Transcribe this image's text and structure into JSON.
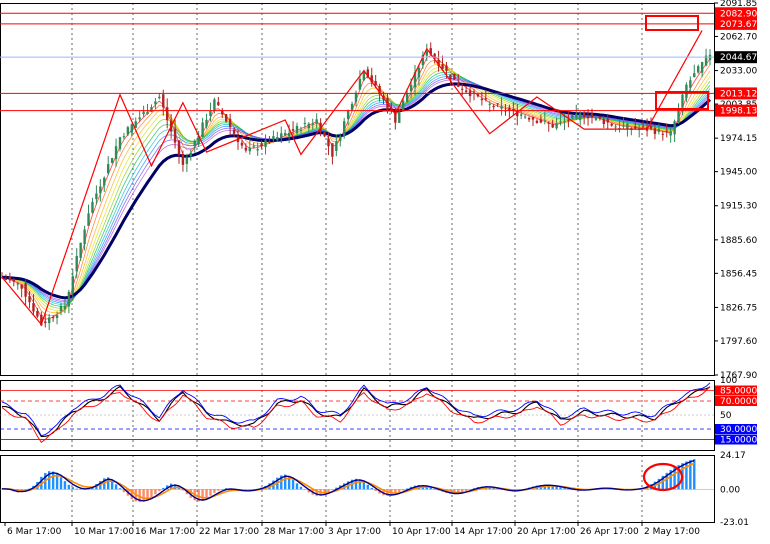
{
  "colors": {
    "bull": "#2e8b57",
    "bear": "#b22222",
    "zigzag": "#ff0000",
    "ma_slow": "#000066",
    "level": "#ff0000",
    "current": "#9bb4ff",
    "macd_up": "#1e90ff",
    "macd_down": "#ff8a65",
    "signal": "#ff8c00",
    "macd_line": "#00008b",
    "rsi_main": "#000000",
    "rsi_fast": "#0000ff",
    "rsi_slow": "#ff0000",
    "box": "#ff0000"
  },
  "chart_data": [
    {
      "type": "candlestick",
      "name": "price",
      "ylim": [
        1767.9,
        2091.85
      ],
      "yticks": [
        2091.85,
        2062.7,
        2033.0,
        2003.85,
        1974.15,
        1945.0,
        1915.3,
        1885.6,
        1856.45,
        1826.75,
        1797.6,
        1767.9
      ],
      "xlabels": [
        "6 Mar 17:00",
        "10 Mar 17:00",
        "16 Mar 17:00",
        "22 Mar 17:00",
        "28 Mar 17:00",
        "3 Apr 17:00",
        "10 Apr 17:00",
        "14 Apr 17:00",
        "20 Apr 17:00",
        "26 Apr 17:00",
        "2 May 17:00"
      ],
      "levels": [
        {
          "value": 2082.9,
          "label": "2082.90",
          "style": "line"
        },
        {
          "value": 2073.67,
          "label": "2073.67",
          "style": "line"
        },
        {
          "value": 2044.67,
          "label": "2044.67",
          "style": "current"
        },
        {
          "value": 2013.12,
          "label": "2013.12",
          "style": "line"
        },
        {
          "value": 1998.13,
          "label": "1998.13",
          "style": "line"
        }
      ],
      "path": [
        [
          0,
          1853
        ],
        [
          5,
          1845
        ],
        [
          10,
          1812
        ],
        [
          16,
          1828
        ],
        [
          22,
          1910
        ],
        [
          30,
          1975
        ],
        [
          40,
          2010
        ],
        [
          46,
          1950
        ],
        [
          54,
          2006
        ],
        [
          62,
          1962
        ],
        [
          72,
          1978
        ],
        [
          80,
          1990
        ],
        [
          84,
          1960
        ],
        [
          92,
          2035
        ],
        [
          100,
          1990
        ],
        [
          108,
          2052
        ],
        [
          116,
          2020
        ],
        [
          124,
          2003
        ],
        [
          132,
          1995
        ],
        [
          140,
          1985
        ],
        [
          148,
          1995
        ],
        [
          156,
          1985
        ],
        [
          164,
          1982
        ],
        [
          170,
          1978
        ],
        [
          174,
          2020
        ],
        [
          180,
          2048
        ]
      ],
      "zigzag": [
        [
          0,
          1853
        ],
        [
          10,
          1812
        ],
        [
          30,
          2012
        ],
        [
          38,
          1950
        ],
        [
          46,
          2005
        ],
        [
          52,
          1962
        ],
        [
          72,
          1990
        ],
        [
          76,
          1960
        ],
        [
          92,
          2033
        ],
        [
          100,
          1995
        ],
        [
          108,
          2052
        ],
        [
          124,
          1978
        ],
        [
          136,
          2010
        ],
        [
          148,
          1982
        ],
        [
          164,
          1982
        ],
        [
          178,
          2068
        ]
      ],
      "macd": [
        0.4,
        0.2,
        -0.2,
        -1.5,
        -2.2,
        -1.8,
        -1.0,
        0.5,
        2.5,
        5.2,
        8.8,
        11.5,
        12.8,
        12.5,
        10.8,
        8.5,
        5.8,
        3.2,
        1.5,
        0.5,
        -0.4,
        -0.2,
        0.8,
        2.0,
        3.8,
        5.8,
        7.8,
        8.4,
        6.2,
        3.5,
        0.8,
        -2.0,
        -4.5,
        -7.0,
        -8.5,
        -9.0,
        -8.5,
        -7.0,
        -5.5,
        -3.5,
        -1.2,
        1.0,
        2.8,
        4.0,
        3.5,
        1.8,
        -0.8,
        -3.5,
        -6.0,
        -7.8,
        -8.5,
        -8.0,
        -6.5,
        -4.5,
        -2.5,
        -1.0,
        0.2,
        0.8,
        0.6,
        0.0,
        -0.6,
        -1.2,
        -1.4,
        -1.0,
        -0.4,
        0.4,
        1.2,
        2.4,
        4.2,
        6.2,
        8.2,
        9.8,
        10.4,
        9.0,
        6.8,
        4.2,
        1.8,
        -0.3,
        -2.2,
        -3.8,
        -4.8,
        -4.5,
        -3.5,
        -2.0,
        -0.4,
        1.2,
        2.8,
        4.2,
        5.6,
        6.8,
        7.4,
        6.8,
        5.2,
        3.2,
        1.0,
        -1.2,
        -3.0,
        -4.2,
        -4.6,
        -4.3,
        -3.4,
        -2.1,
        -0.8,
        0.6,
        1.8,
        2.6,
        3.0,
        2.8,
        2.2,
        1.2,
        0.2,
        -0.8,
        -1.8,
        -2.6,
        -3.2,
        -3.4,
        -3.0,
        -2.2,
        -1.2,
        -0.2,
        0.8,
        1.6,
        2.0,
        2.2,
        1.8,
        1.2,
        0.5,
        -0.2,
        -0.8,
        -1.2,
        -1.4,
        -1.0,
        -0.4,
        0.4,
        1.2,
        2.0,
        2.6,
        3.0,
        3.2,
        3.0,
        2.6,
        2.0,
        1.4,
        0.8,
        0.2,
        -0.3,
        -0.6,
        -0.8,
        -0.6,
        -0.2,
        0.2,
        0.6,
        0.9,
        1.0,
        0.8,
        0.4,
        0.0,
        -0.4,
        -0.6,
        -0.5,
        -0.2,
        0.2,
        0.6,
        1.2,
        2.2,
        3.6,
        5.4,
        7.4,
        9.5,
        11.6,
        13.6,
        15.4,
        17.0,
        18.4,
        19.6,
        20.6,
        21.2
      ],
      "rsi_breaks": [
        [
          0,
          62
        ],
        [
          6,
          48
        ],
        [
          10,
          18
        ],
        [
          14,
          30
        ],
        [
          18,
          56
        ],
        [
          26,
          75
        ],
        [
          30,
          88
        ],
        [
          36,
          62
        ],
        [
          40,
          44
        ],
        [
          46,
          84
        ],
        [
          52,
          52
        ],
        [
          58,
          38
        ],
        [
          64,
          36
        ],
        [
          70,
          66
        ],
        [
          76,
          72
        ],
        [
          80,
          54
        ],
        [
          86,
          46
        ],
        [
          92,
          86
        ],
        [
          98,
          60
        ],
        [
          104,
          70
        ],
        [
          108,
          87
        ],
        [
          114,
          62
        ],
        [
          120,
          44
        ],
        [
          126,
          50
        ],
        [
          132,
          56
        ],
        [
          136,
          68
        ],
        [
          142,
          42
        ],
        [
          148,
          54
        ],
        [
          154,
          50
        ],
        [
          160,
          48
        ],
        [
          166,
          46
        ],
        [
          172,
          70
        ],
        [
          176,
          80
        ],
        [
          180,
          93
        ]
      ]
    },
    {
      "type": "line",
      "name": "oscillator",
      "ylim": [
        0,
        100
      ],
      "yticks": [
        100,
        50,
        30.0,
        15.0
      ],
      "ylabels": [
        "100",
        "50"
      ],
      "levels": [
        {
          "value": 85,
          "label": "85.0000",
          "color": "#ff0000"
        },
        {
          "value": 70,
          "label": "70.0000",
          "color": "#ff0000"
        },
        {
          "value": 30,
          "label": "30.0000",
          "color": "#0000ff"
        },
        {
          "value": 15,
          "label": "15.0000",
          "color": "#0000ff"
        }
      ]
    },
    {
      "type": "bar",
      "name": "macd",
      "ylim": [
        -23.01,
        24.17
      ],
      "yticks": [
        24.17,
        0.0,
        -23.01
      ],
      "ylabels": [
        "24.17",
        "0.00",
        "-23.01"
      ]
    }
  ]
}
